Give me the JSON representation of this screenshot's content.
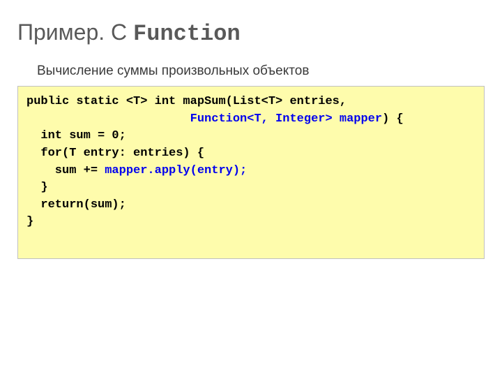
{
  "title_plain": "Пример. С ",
  "title_code": "Function",
  "subtitle": "Вычисление суммы произвольных объектов",
  "code": {
    "line1": "public static <T> int mapSum(List<T> entries,",
    "line2_indent": "                       ",
    "line2_hl": "Function<T, Integer> mapper",
    "line2_tail": ") {",
    "line3": "  int sum = 0;",
    "line4": "  for(T entry: entries) {",
    "line5_prefix": "    sum += ",
    "line5_hl": "mapper.apply(entry);",
    "line6": "  }",
    "line7": "  return(sum);",
    "line8": "}"
  }
}
